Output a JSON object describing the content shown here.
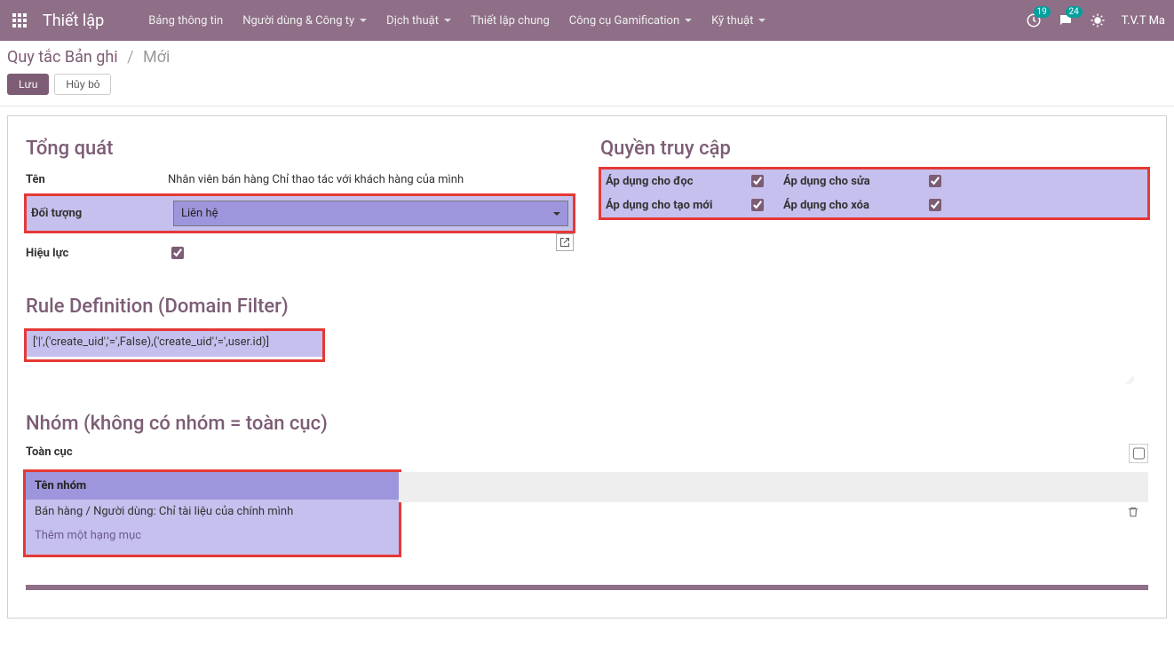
{
  "topbar": {
    "brand": "Thiết lập",
    "menus": [
      {
        "label": "Bảng thông tin",
        "dropdown": false
      },
      {
        "label": "Người dùng & Công ty",
        "dropdown": true
      },
      {
        "label": "Dịch thuật",
        "dropdown": true
      },
      {
        "label": "Thiết lập chung",
        "dropdown": false
      },
      {
        "label": "Công cụ Gamification",
        "dropdown": true
      },
      {
        "label": "Kỹ thuật",
        "dropdown": true
      }
    ],
    "badge1": "19",
    "badge2": "24",
    "user": "T.V.T Ma"
  },
  "breadcrumb": {
    "root": "Quy tắc Bản ghi",
    "current": "Mới"
  },
  "buttons": {
    "save": "Lưu",
    "discard": "Hủy bỏ"
  },
  "sections": {
    "general": "Tổng quát",
    "access": "Quyền truy cập",
    "rule": "Rule Definition (Domain Filter)",
    "groups": "Nhóm (không có nhóm = toàn cục)"
  },
  "general": {
    "name_label": "Tên",
    "name_value": "Nhân viên bán hàng Chỉ thao tác với khách hàng của mình",
    "object_label": "Đối tượng",
    "object_value": "Liên hệ",
    "active_label": "Hiệu lực"
  },
  "access": {
    "read": "Áp dụng cho đọc",
    "write": "Áp dụng cho sửa",
    "create": "Áp dụng cho tạo mới",
    "delete": "Áp dụng cho xóa"
  },
  "domain": {
    "value": "['|',('create_uid','=',False),('create_uid','=',user.id)]"
  },
  "groups_section": {
    "global_label": "Toàn cục",
    "col_header": "Tên nhóm",
    "row0": "Bán hàng / Người dùng: Chỉ tài liệu của chính mình",
    "add_label": "Thêm một hạng mục"
  }
}
